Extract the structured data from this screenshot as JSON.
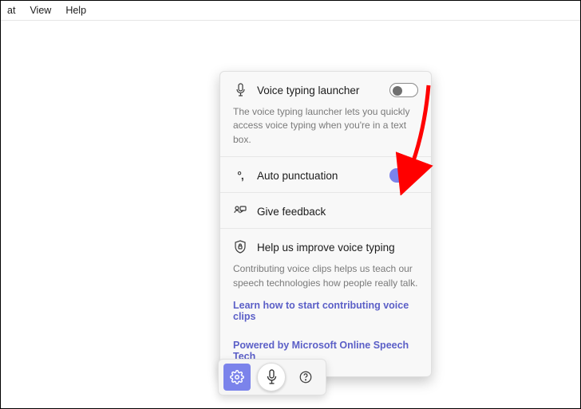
{
  "menubar": {
    "items": [
      "at",
      "View",
      "Help"
    ]
  },
  "panel": {
    "launcher": {
      "label": "Voice typing launcher",
      "desc": "The voice typing launcher lets you quickly access voice typing when you're in a text box.",
      "on": false
    },
    "autopunct": {
      "label": "Auto punctuation",
      "on": true
    },
    "feedback": {
      "label": "Give feedback"
    },
    "improve": {
      "label": "Help us improve voice typing",
      "desc": "Contributing voice clips helps us teach our speech technologies how people really talk.",
      "link": "Learn how to start contributing voice clips"
    },
    "powered": "Powered by Microsoft Online Speech Tech"
  }
}
